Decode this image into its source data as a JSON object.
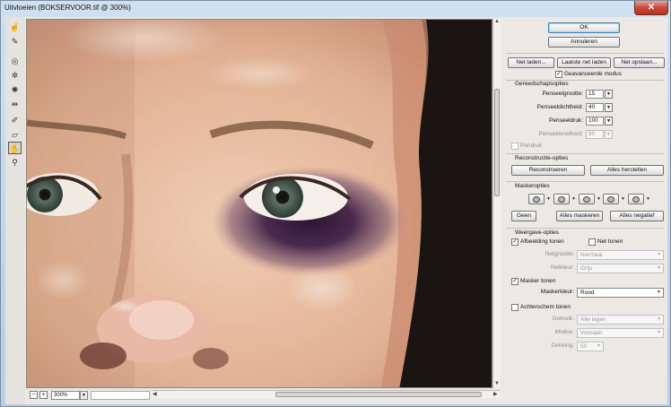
{
  "window": {
    "title": "Uitvloeien (BOKSERVOOR.tif @ 300%)",
    "close_glyph": "✕"
  },
  "toolbar": {
    "tools": [
      "forward-warp-icon",
      "reconstruct-icon",
      "twirl-icon",
      "pucker-icon",
      "bloat-icon",
      "push-left-icon",
      "freeze-mask-icon",
      "thaw-mask-icon",
      "hand-icon",
      "zoom-icon"
    ],
    "active_tool": "hand-icon"
  },
  "statusbar": {
    "zoom": "300%",
    "minus": "−",
    "plus": "+"
  },
  "buttons": {
    "ok": "OK",
    "cancel": "Annuleren",
    "load_mesh": "Net laden...",
    "load_last_mesh": "Laatste net laden",
    "save_mesh": "Net opslaan..."
  },
  "advanced_mode": {
    "label": "Geavanceerde modus",
    "checked": true
  },
  "tool_options": {
    "title": "Gereedschapsopties",
    "brush_size": {
      "label": "Penseelgrootte:",
      "value": "15"
    },
    "brush_density": {
      "label": "Penseeldichtheid:",
      "value": "40"
    },
    "brush_pressure": {
      "label": "Penseeldruk:",
      "value": "100"
    },
    "brush_rate": {
      "label": "Penseelsnelheid:",
      "value": "80"
    },
    "stylus_pressure": {
      "label": "Pendruk",
      "checked": false
    }
  },
  "reconstruct": {
    "title": "Reconstructie-opties",
    "reconstruct_button": "Reconstrueren",
    "restore_all_button": "Alles herstellen"
  },
  "mask": {
    "title": "Maskeropties",
    "none_button": "Geen",
    "mask_all_button": "Alles maskeren",
    "invert_all_button": "Alles negatief"
  },
  "view": {
    "title": "Weergave-opties",
    "show_image": {
      "label": "Afbeelding tonen",
      "checked": true
    },
    "show_mesh": {
      "label": "Net tonen",
      "checked": false
    },
    "mesh_size": {
      "label": "Netgrootte:",
      "value": "Normaal"
    },
    "mesh_color": {
      "label": "Netkleur:",
      "value": "Grijs"
    },
    "show_mask": {
      "label": "Masker tonen",
      "checked": true
    },
    "mask_color": {
      "label": "Maskerkleur:",
      "value": "Rood"
    },
    "show_backdrop": {
      "label": "Achterschem tonen",
      "checked": false
    },
    "use": {
      "label": "Gebruik:",
      "value": "Alle lagen"
    },
    "mode": {
      "label": "Modus:",
      "value": "Vooraan"
    },
    "opacity": {
      "label": "Dekking:",
      "value": "50"
    }
  },
  "colors": {
    "skin": "#e7c1a6",
    "bruise": "#4a2a4e",
    "ok_border": "#3c7fb1"
  }
}
